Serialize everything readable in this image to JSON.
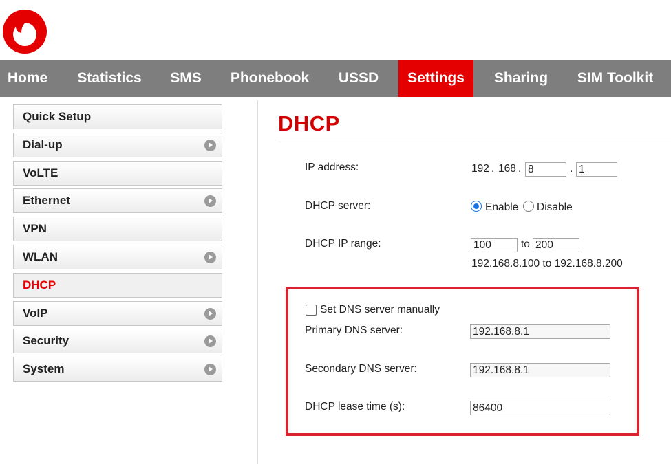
{
  "brand": {
    "logo_icon": "vodafone-logo-icon",
    "accent": "#e40000"
  },
  "nav": {
    "items": [
      {
        "label": "Home"
      },
      {
        "label": "Statistics"
      },
      {
        "label": "SMS"
      },
      {
        "label": "Phonebook"
      },
      {
        "label": "USSD"
      },
      {
        "label": "Settings",
        "active": true
      },
      {
        "label": "Sharing"
      },
      {
        "label": "SIM Toolkit"
      }
    ]
  },
  "sidebar": {
    "items": [
      {
        "label": "Quick Setup",
        "has_arrow": false
      },
      {
        "label": "Dial-up",
        "has_arrow": true
      },
      {
        "label": "VoLTE",
        "has_arrow": false
      },
      {
        "label": "Ethernet",
        "has_arrow": true
      },
      {
        "label": "VPN",
        "has_arrow": false
      },
      {
        "label": "WLAN",
        "has_arrow": true
      },
      {
        "label": "DHCP",
        "has_arrow": false,
        "active": true
      },
      {
        "label": "VoIP",
        "has_arrow": true
      },
      {
        "label": "Security",
        "has_arrow": true
      },
      {
        "label": "System",
        "has_arrow": true
      }
    ]
  },
  "page": {
    "title": "DHCP"
  },
  "form": {
    "ip_address": {
      "label": "IP address:",
      "octet1": "192",
      "dot": ".",
      "octet2": "168",
      "octet3": "8",
      "octet4": "1"
    },
    "dhcp_server": {
      "label": "DHCP server:",
      "enable_label": "Enable",
      "disable_label": "Disable",
      "selected": "Enable"
    },
    "dhcp_range": {
      "label": "DHCP IP range:",
      "start": "100",
      "to_label": "to",
      "end": "200",
      "summary": "192.168.8.100 to 192.168.8.200"
    },
    "dns": {
      "manual_label": "Set DNS server manually",
      "manual_checked": false,
      "primary_label": "Primary DNS server:",
      "primary_value": "192.168.8.1",
      "secondary_label": "Secondary DNS server:",
      "secondary_value": "192.168.8.1"
    },
    "lease": {
      "label": "DHCP lease time (s):",
      "value": "86400"
    }
  }
}
